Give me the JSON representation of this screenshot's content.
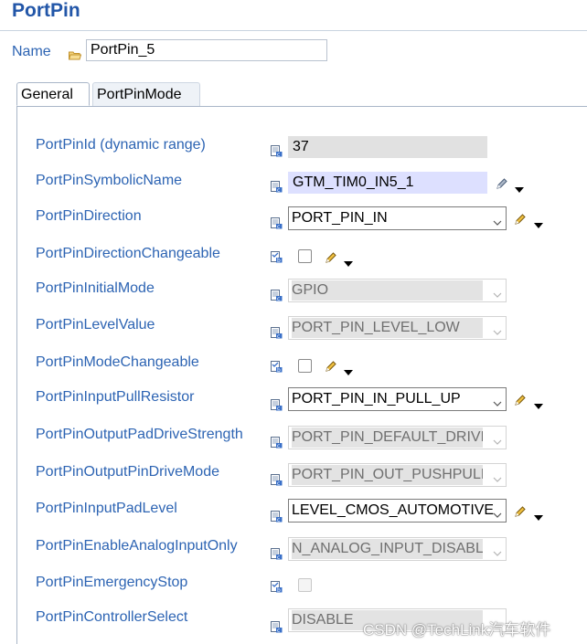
{
  "title": "PortPin",
  "name_label": "Name",
  "name_value": "PortPin_5",
  "tabs": [
    {
      "label": "General"
    },
    {
      "label": "PortPinMode"
    }
  ],
  "rows": [
    {
      "label": "PortPinId (dynamic range)",
      "value": "37"
    },
    {
      "label": "PortPinSymbolicName",
      "value": "GTM_TIM0_IN5_1"
    },
    {
      "label": "PortPinDirection",
      "value": "PORT_PIN_IN"
    },
    {
      "label": "PortPinDirectionChangeable"
    },
    {
      "label": "PortPinInitialMode",
      "value": "GPIO"
    },
    {
      "label": "PortPinLevelValue",
      "value": "PORT_PIN_LEVEL_LOW"
    },
    {
      "label": "PortPinModeChangeable"
    },
    {
      "label": "PortPinInputPullResistor",
      "value": "PORT_PIN_IN_PULL_UP"
    },
    {
      "label": "PortPinOutputPadDriveStrength",
      "value": "PORT_PIN_DEFAULT_DRIVER"
    },
    {
      "label": "PortPinOutputPinDriveMode",
      "value": "PORT_PIN_OUT_PUSHPULL"
    },
    {
      "label": "PortPinInputPadLevel",
      "value": "LEVEL_CMOS_AUTOMOTIVE"
    },
    {
      "label": "PortPinEnableAnalogInputOnly",
      "value": "N_ANALOG_INPUT_DISABLE"
    },
    {
      "label": "PortPinEmergencyStop"
    },
    {
      "label": "PortPinControllerSelect",
      "value": "DISABLE"
    }
  ],
  "watermark": "CSDN @TechLink汽车软件",
  "icons": {
    "name": "folder-icon",
    "field_calc": "calculator-icon",
    "field_bool": "boolean-icon",
    "edit": "pencil-icon",
    "menu": "dropdown-arrow-icon"
  },
  "colors": {
    "label": "#2d64b3",
    "title": "#2256a8",
    "readonly_bg": "#e1e1e1",
    "selected_bg": "#dde0ff"
  }
}
